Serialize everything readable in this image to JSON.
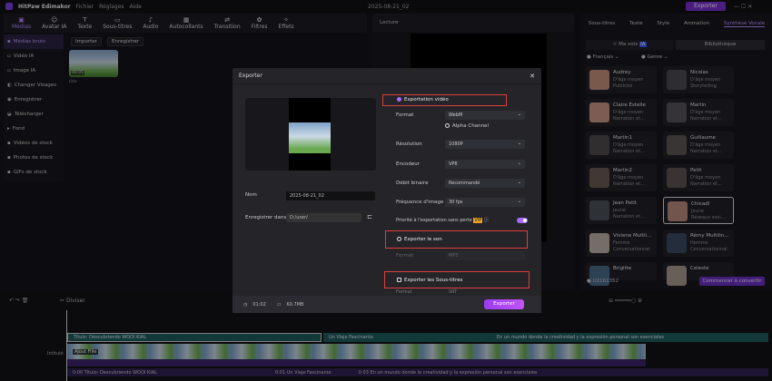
{
  "app": {
    "title": "HitPaw Edimakor",
    "menus": [
      "Fichier",
      "Réglages",
      "Aide"
    ],
    "project": "2025-08-21_02",
    "export_label": "Exporter"
  },
  "toolbar": [
    {
      "icon": "media-icon",
      "label": "Médias"
    },
    {
      "icon": "avatar-icon",
      "label": "Avatar IA"
    },
    {
      "icon": "text-icon",
      "label": "Texte"
    },
    {
      "icon": "subtitles-icon",
      "label": "Sous-titres"
    },
    {
      "icon": "audio-icon",
      "label": "Audio"
    },
    {
      "icon": "sticker-icon",
      "label": "Autocollants"
    },
    {
      "icon": "transition-icon",
      "label": "Transition"
    },
    {
      "icon": "filter-icon",
      "label": "Filtres"
    },
    {
      "icon": "effects-icon",
      "label": "Effets"
    }
  ],
  "sidebar": [
    "Médias bruts",
    "Vidéo IA",
    "Image IA",
    "Changer Visages",
    "Enregistrer",
    "Télécharger",
    "Fond",
    "Vidéos de stock",
    "Photos de stock",
    "GIFs de stock"
  ],
  "media": {
    "import": "Importer",
    "record": "Enregistrer",
    "clip_duration": "00:05",
    "clip_name": "title"
  },
  "preview": {
    "title": "Lecture"
  },
  "right": {
    "tabs": [
      "Sous-titres",
      "Texte",
      "Style",
      "Animation",
      "Synthèse Vocale"
    ],
    "my_voice": "Ma voix",
    "badge": "IA",
    "library": "Bibliothèque",
    "lang": "Français",
    "gender": "Genre",
    "voices": [
      [
        "Audrey",
        "D'âge moyen",
        "Publicité"
      ],
      [
        "Nicolas",
        "D'âge moyen",
        "Storytelling"
      ],
      [
        "Claire Estelle",
        "D'âge moyen",
        "Narration et..."
      ],
      [
        "Martin",
        "D'âge moyen",
        "Narration et..."
      ],
      [
        "Martin1",
        "D'âge moyen",
        "Narration et..."
      ],
      [
        "Guillaume",
        "D'âge moyen",
        "Narration et..."
      ],
      [
        "Martin2",
        "D'âge moyen",
        "Narration et..."
      ],
      [
        "Petit",
        "D'âge moyen",
        "Narration et..."
      ],
      [
        "Jean Petit",
        "Jeune",
        "Narration et..."
      ],
      [
        "Chicadi",
        "Jeune",
        "Réseaux soci..."
      ],
      [
        "Viviene Multil...",
        "Femme",
        "Conversationnel"
      ],
      [
        "Rémy Multilin...",
        "Homme",
        "Conversationnel"
      ],
      [
        "Brigitte",
        "",
        ""
      ],
      [
        "Celeste",
        "",
        ""
      ]
    ],
    "credits": "U2161352",
    "convert": "Commencer à convertir"
  },
  "timeline": {
    "split": "Diviser",
    "track_label": "Intitulé",
    "clip_fill": "Ajout Fille",
    "title1": "Titulo: Descubriendo WOOI KIAL",
    "title2": "Un Viaje Fascinante",
    "title3": "En un mundo donde la creatividad y la expresión personal son esenciales",
    "sub1": "0:00 Titulo: Descubriendo WOOI KIAL",
    "sub2": "0:01 Un Viaje Fascinante",
    "sub3": "0:03 En un mundo donde la creatividad y la expresión personal son esenciales"
  },
  "modal": {
    "title": "Exporter",
    "name_label": "Nom",
    "name_value": "2025-08-21_02",
    "save_label": "Enregistrer dans",
    "save_value": "D:/user/",
    "duration": "01:02",
    "size": "60.7MB",
    "video_export": "Exportation vidéo",
    "format_label": "Format",
    "format": "WebM",
    "alpha": "Alpha Channel",
    "res_label": "Résolution",
    "res": "1080P",
    "enc_label": "Encodeur",
    "enc": "VP8",
    "bitrate_label": "Débit binaire",
    "bitrate": "Recommandé",
    "fps_label": "Fréquence d'image",
    "fps": "30 fps",
    "lossless": "Priorité à l'exportation sans perte",
    "vip": "VIP",
    "lossless_on": true,
    "audio_export": "Exporter le son",
    "audio_format": "MP3",
    "sub_export": "Exporter les Sous-titres",
    "sub_format": "SRT",
    "export": "Exporter"
  },
  "colors": {
    "accent": "#a76bff",
    "highlight": "#e0403a"
  }
}
